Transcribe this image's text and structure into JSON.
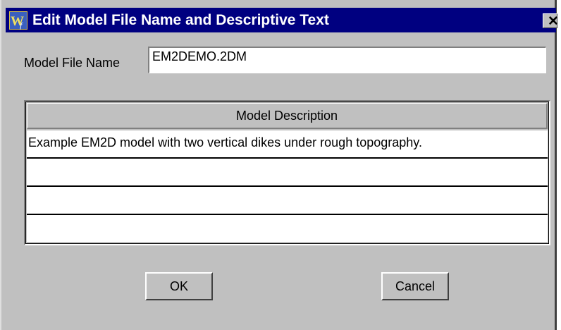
{
  "window": {
    "title": "Edit Model File Name and Descriptive Text",
    "close_glyph": "✕",
    "titlebar_color": "#000080",
    "face_color": "#c0c0c0"
  },
  "file_name": {
    "label": "Model File Name",
    "value": "EM2DEMO.2DM"
  },
  "description_table": {
    "header": "Model Description",
    "rows": [
      "Example EM2D model with two vertical dikes under rough topography.",
      "",
      "",
      ""
    ]
  },
  "buttons": {
    "ok_label": "OK",
    "cancel_label": "Cancel"
  }
}
